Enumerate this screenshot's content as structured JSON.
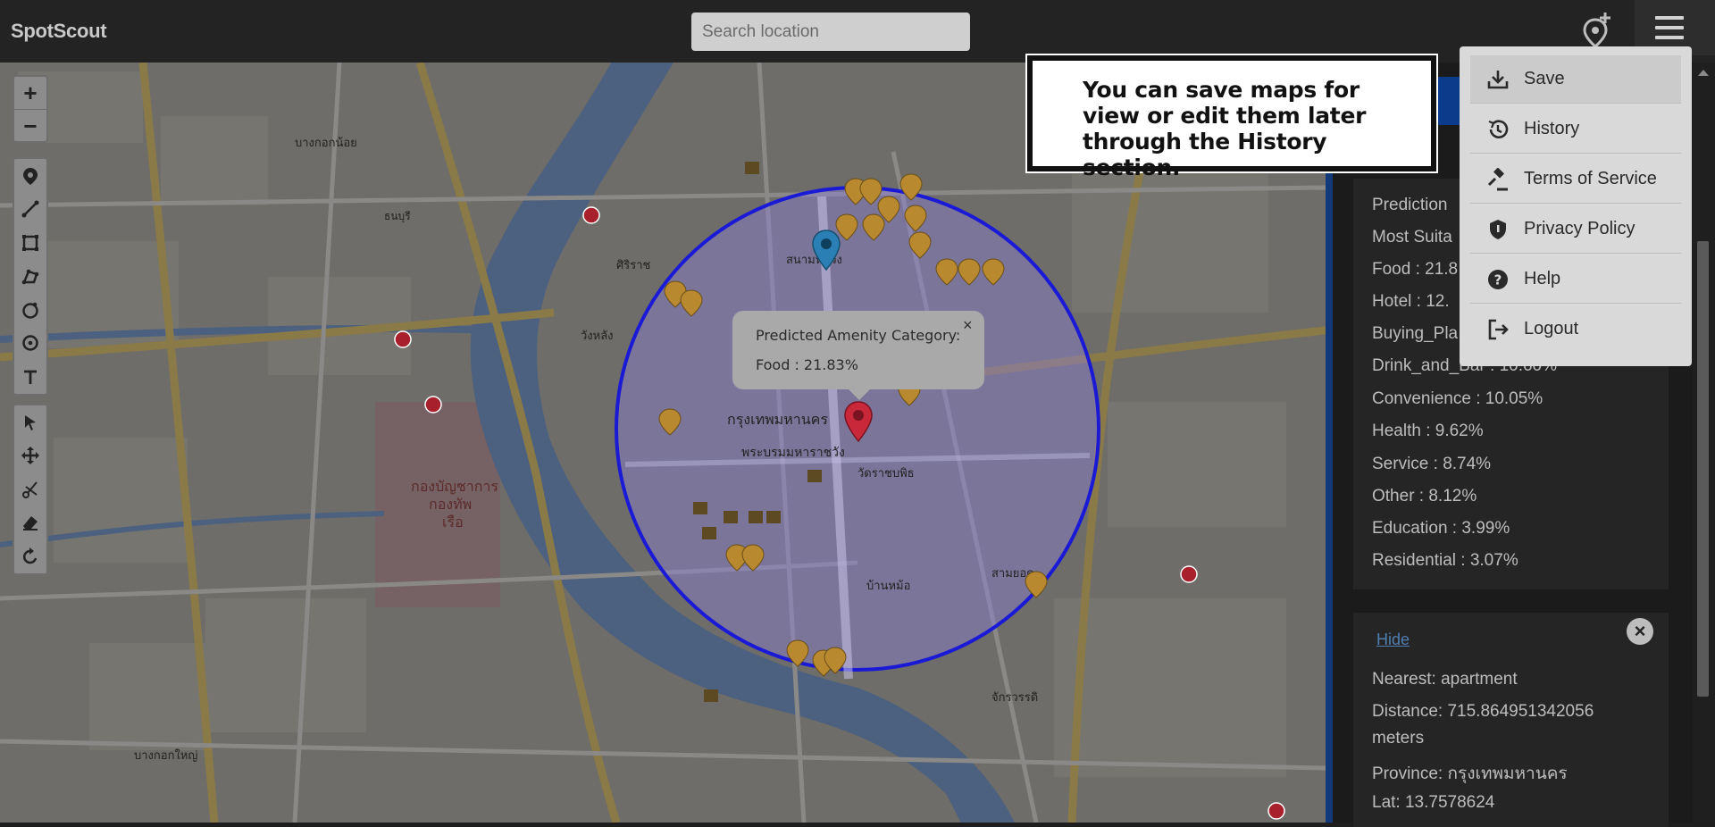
{
  "app": {
    "brand": "SpotScout"
  },
  "search": {
    "placeholder": "Search location"
  },
  "toolbar": {
    "zoom_in": "+",
    "zoom_out": "−"
  },
  "popup": {
    "title": "Predicted Amenity Category:",
    "value": "Food : 21.83%",
    "close": "×"
  },
  "tour_tip": {
    "text": "You can save maps for view or edit them later through the History section."
  },
  "menu": {
    "items": [
      {
        "label": "Save",
        "icon": "download-icon"
      },
      {
        "label": "History",
        "icon": "history-icon"
      },
      {
        "label": "Terms of Service",
        "icon": "gavel-icon"
      },
      {
        "label": "Privacy Policy",
        "icon": "shield-icon"
      },
      {
        "label": "Help",
        "icon": "help-icon"
      },
      {
        "label": "Logout",
        "icon": "logout-icon"
      }
    ]
  },
  "panel": {
    "stats": [
      "Prediction",
      "Most Suita",
      "Food : 21.8",
      "Hotel : 12.",
      "Buying_Pla",
      "Drink_and_Bar : 10.60%",
      "Convenience : 10.05%",
      "Health : 9.62%",
      "Service : 8.74%",
      "Other : 8.12%",
      "Education : 3.99%",
      "Residential : 3.07%"
    ],
    "hide_label": "Hide",
    "close_label": "×",
    "nearest": "Nearest: apartment",
    "distance_line1": "Distance: 715.864951342056",
    "distance_line2": "meters",
    "province": "Province: กรุงเทพมหานคร",
    "lat": "Lat: 13.7578624"
  },
  "map_labels": [
    "กรุงเทพมหานคร",
    "พระบรมมหาราชวัง",
    "วัดราชบพิธ",
    "บ้านหม้อ",
    "สามยอด",
    "ศิริราช",
    "กองบัญชาการกองทัพเรือ",
    "วังหลัง",
    "บางกอกน้อย",
    "บางกอกใหญ่",
    "จักรวรรดิ",
    "สนามหลวง",
    "ธนบุรี"
  ],
  "colors": {
    "circle": "#1a1ad6",
    "circle_fill": "#8b7fd6",
    "marker_red": "#c8283a",
    "marker_blue": "#2a7fb5",
    "poi": "#b8892e"
  }
}
